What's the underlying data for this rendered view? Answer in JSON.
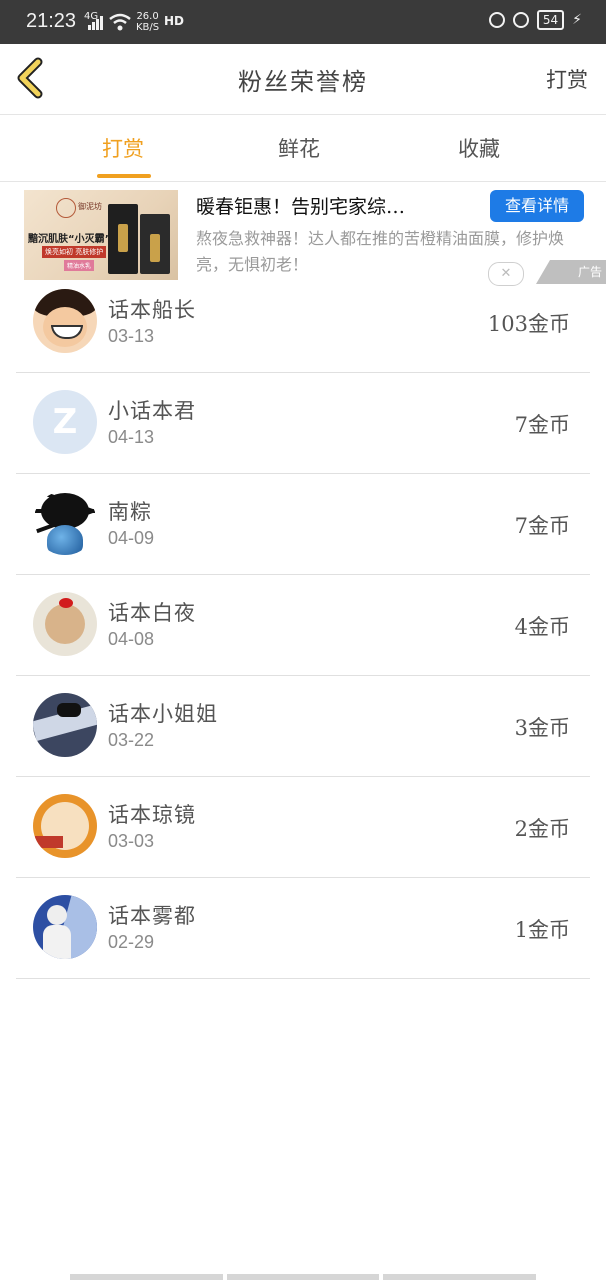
{
  "status_bar": {
    "time": "21:23",
    "network": "4G",
    "speed_value": "26.0",
    "speed_unit": "KB/S",
    "hd_label": "HD",
    "battery": "54"
  },
  "header": {
    "title": "粉丝荣誉榜",
    "action_label": "打赏"
  },
  "tabs": [
    {
      "label": "打赏",
      "active": true
    },
    {
      "label": "鲜花",
      "active": false
    },
    {
      "label": "收藏",
      "active": false
    }
  ],
  "ad": {
    "thumb_brand": "御泥坊",
    "thumb_text1": "黯沉肌肤“小灭霸”",
    "thumb_text2": "焕亮如初 亮肤修护",
    "thumb_text3": "精油水乳",
    "headline": "暖春钜惠！告别宅家综…",
    "cta_label": "查看详情",
    "description": "熬夜急救神器！达人都在推的苦橙精油面膜，修护焕亮，无惧初老！",
    "close_label": "✕",
    "ad_tag": "广告"
  },
  "leaderboard": [
    {
      "name": "话本船长",
      "date": "03-13",
      "amount": "103金币"
    },
    {
      "name": "小话本君",
      "date": "04-13",
      "amount": "7金币"
    },
    {
      "name": "南粽",
      "date": "04-09",
      "amount": "7金币"
    },
    {
      "name": "话本白夜",
      "date": "04-08",
      "amount": "4金币"
    },
    {
      "name": "话本小姐姐",
      "date": "03-22",
      "amount": "3金币"
    },
    {
      "name": "话本琼镜",
      "date": "03-03",
      "amount": "2金币"
    },
    {
      "name": "话本雾都",
      "date": "02-29",
      "amount": "1金币"
    }
  ],
  "colors": {
    "accent": "#f0a020",
    "cta": "#1e7be6",
    "status_bar": "#3a3a3a"
  }
}
